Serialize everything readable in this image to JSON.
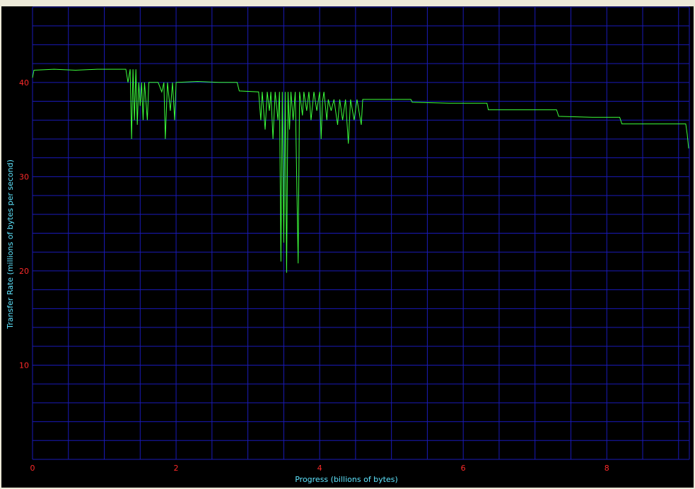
{
  "chart_data": {
    "type": "line",
    "title": "",
    "xlabel": "Progress (billions of bytes)",
    "ylabel": "Transfer Rate (millions of bytes per second)",
    "xlim": [
      0,
      9.15
    ],
    "ylim": [
      0,
      48
    ],
    "x_ticks": [
      0,
      2,
      4,
      6,
      8
    ],
    "y_ticks": [
      10,
      20,
      30,
      40
    ],
    "grid": true,
    "colors": {
      "background": "#000000",
      "grid": "#1a1ab8",
      "line": "#3cff3c",
      "tick_labels": "#ff2a2a",
      "axis_labels": "#5fe6ff"
    },
    "series": [
      {
        "values": [
          [
            0.0,
            40.5
          ],
          [
            0.02,
            41.3
          ],
          [
            0.3,
            41.4
          ],
          [
            0.6,
            41.3
          ],
          [
            0.9,
            41.4
          ],
          [
            1.3,
            41.4
          ],
          [
            1.33,
            40.0
          ],
          [
            1.36,
            41.4
          ],
          [
            1.38,
            34.0
          ],
          [
            1.4,
            41.4
          ],
          [
            1.42,
            36.0
          ],
          [
            1.44,
            41.4
          ],
          [
            1.46,
            35.5
          ],
          [
            1.48,
            40.0
          ],
          [
            1.5,
            37.5
          ],
          [
            1.52,
            40.0
          ],
          [
            1.54,
            36.0
          ],
          [
            1.56,
            40.0
          ],
          [
            1.58,
            38.0
          ],
          [
            1.6,
            36.0
          ],
          [
            1.62,
            40.0
          ],
          [
            1.75,
            40.0
          ],
          [
            1.8,
            39.0
          ],
          [
            1.83,
            40.0
          ],
          [
            1.85,
            34.0
          ],
          [
            1.88,
            40.0
          ],
          [
            1.92,
            37.0
          ],
          [
            1.95,
            40.0
          ],
          [
            1.98,
            36.0
          ],
          [
            2.0,
            40.0
          ],
          [
            2.3,
            40.1
          ],
          [
            2.6,
            40.0
          ],
          [
            2.85,
            40.0
          ],
          [
            2.88,
            39.1
          ],
          [
            3.15,
            39.0
          ],
          [
            3.18,
            36.0
          ],
          [
            3.2,
            39.0
          ],
          [
            3.24,
            35.0
          ],
          [
            3.27,
            39.0
          ],
          [
            3.3,
            37.0
          ],
          [
            3.32,
            39.0
          ],
          [
            3.35,
            34.0
          ],
          [
            3.38,
            39.0
          ],
          [
            3.42,
            36.0
          ],
          [
            3.44,
            39.0
          ],
          [
            3.46,
            21.0
          ],
          [
            3.48,
            39.0
          ],
          [
            3.5,
            23.0
          ],
          [
            3.52,
            39.0
          ],
          [
            3.54,
            19.8
          ],
          [
            3.56,
            39.0
          ],
          [
            3.58,
            35.0
          ],
          [
            3.6,
            39.0
          ],
          [
            3.63,
            36.0
          ],
          [
            3.66,
            39.0
          ],
          [
            3.7,
            20.8
          ],
          [
            3.72,
            39.0
          ],
          [
            3.76,
            36.5
          ],
          [
            3.78,
            39.0
          ],
          [
            3.82,
            37.0
          ],
          [
            3.85,
            39.0
          ],
          [
            3.88,
            36.0
          ],
          [
            3.92,
            39.0
          ],
          [
            3.96,
            37.0
          ],
          [
            4.0,
            39.0
          ],
          [
            4.02,
            34.0
          ],
          [
            4.04,
            38.0
          ],
          [
            4.06,
            39.0
          ],
          [
            4.1,
            36.0
          ],
          [
            4.12,
            38.2
          ],
          [
            4.16,
            37.0
          ],
          [
            4.2,
            38.2
          ],
          [
            4.25,
            35.5
          ],
          [
            4.28,
            38.2
          ],
          [
            4.32,
            36.0
          ],
          [
            4.36,
            38.2
          ],
          [
            4.4,
            33.5
          ],
          [
            4.43,
            38.2
          ],
          [
            4.48,
            36.0
          ],
          [
            4.52,
            38.2
          ],
          [
            4.58,
            35.5
          ],
          [
            4.6,
            38.2
          ],
          [
            4.9,
            38.2
          ],
          [
            5.27,
            38.2
          ],
          [
            5.29,
            37.9
          ],
          [
            5.8,
            37.8
          ],
          [
            6.33,
            37.8
          ],
          [
            6.35,
            37.1
          ],
          [
            6.9,
            37.1
          ],
          [
            7.3,
            37.1
          ],
          [
            7.33,
            36.4
          ],
          [
            7.8,
            36.3
          ],
          [
            8.18,
            36.3
          ],
          [
            8.21,
            35.6
          ],
          [
            8.7,
            35.6
          ],
          [
            9.1,
            35.6
          ],
          [
            9.12,
            34.5
          ],
          [
            9.14,
            33.0
          ]
        ]
      }
    ]
  }
}
